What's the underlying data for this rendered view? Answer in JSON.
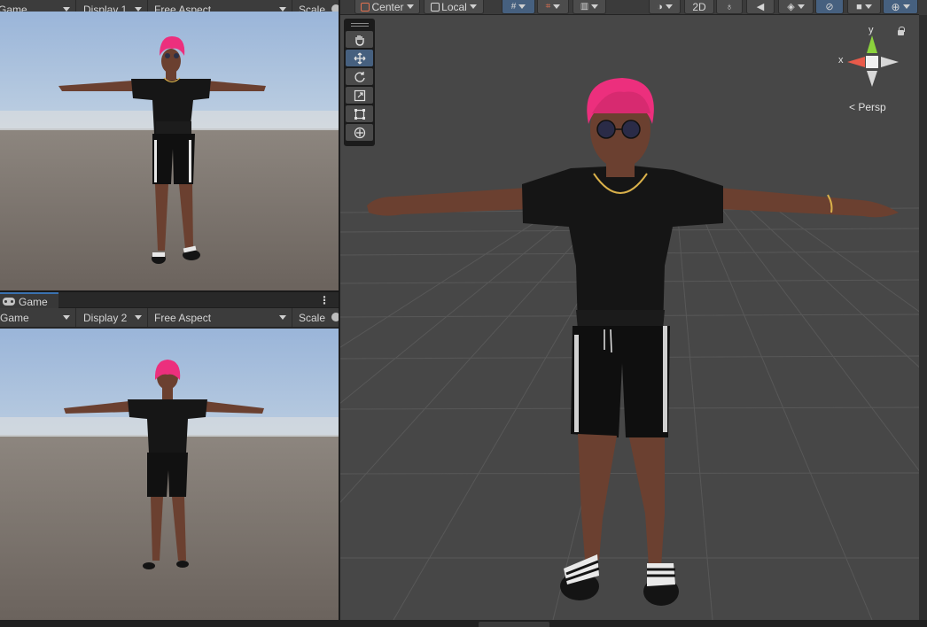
{
  "game_panel_top": {
    "toolbar": {
      "view_label": "Game",
      "display_label": "Display 1",
      "aspect_label": "Free Aspect",
      "scale_label": "Scale"
    }
  },
  "game_panel_bottom": {
    "tab": {
      "label": "Game",
      "icon": "gamepad-icon"
    },
    "menu_icon": "⋮",
    "toolbar": {
      "view_label": "Game",
      "display_label": "Display 2",
      "aspect_label": "Free Aspect",
      "scale_label": "Scale"
    }
  },
  "scene_view": {
    "toolbar": {
      "pivot_label": "Center",
      "space_label": "Local",
      "mode_2d_label": "2D"
    },
    "gizmo": {
      "y_label": "y",
      "x_label": "x",
      "projection_label": "< Persp"
    },
    "tools": [
      "hand-tool",
      "move-tool",
      "rotate-tool",
      "scale-tool",
      "rect-tool",
      "transform-tool"
    ],
    "active_tool": "move-tool"
  },
  "colors": {
    "hair": "#ec2f7d",
    "skin": "#6b4030",
    "shirt": "#161616",
    "accent": "#46607f"
  }
}
